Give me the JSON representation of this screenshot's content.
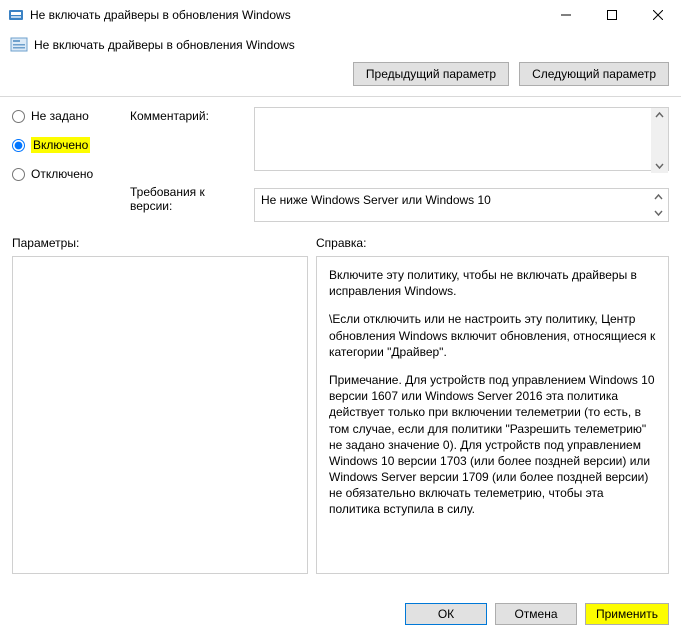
{
  "window": {
    "title": "Не включать драйверы в обновления Windows"
  },
  "subtitle": "Не включать драйверы в обновления Windows",
  "nav": {
    "prev": "Предыдущий параметр",
    "next": "Следующий параметр"
  },
  "radios": {
    "not_configured": "Не задано",
    "enabled": "Включено",
    "disabled": "Отключено",
    "selected": "enabled"
  },
  "labels": {
    "comment": "Комментарий:",
    "requirements": "Требования к версии:",
    "parameters": "Параметры:",
    "help": "Справка:"
  },
  "comment_value": "",
  "requirements_value": "Не ниже Windows Server или Windows 10",
  "help_text": {
    "p1": "Включите эту политику, чтобы не включать драйверы в исправления Windows.",
    "p2": "\\Если отключить или не настроить эту политику, Центр обновления Windows включит обновления, относящиеся к категории \"Драйвер\".",
    "p3": "Примечание. Для устройств под управлением Windows 10 версии 1607 или Windows Server 2016 эта политика действует только при включении телеметрии (то есть, в том случае, если для политики \"Разрешить телеметрию\" не задано значение 0). Для устройств под управлением Windows 10 версии 1703 (или более поздней версии) или Windows Server версии 1709 (или более поздней версии) не обязательно включать телеметрию, чтобы эта политика вступила в силу."
  },
  "footer": {
    "ok": "ОК",
    "cancel": "Отмена",
    "apply": "Применить"
  }
}
